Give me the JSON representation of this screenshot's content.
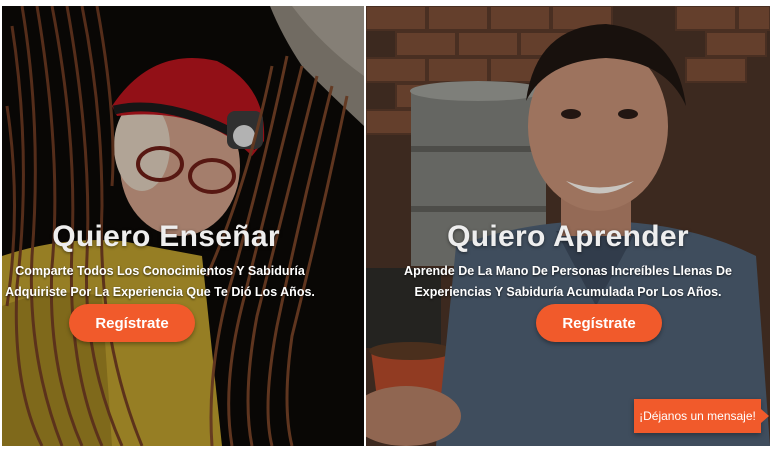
{
  "panels": {
    "teach": {
      "title": "Quiero Enseñar",
      "desc_line1": "Comparte Todos Los Conocimientos Y Sabiduría",
      "desc_line2": "Adquiriste Por La Experiencia Que Te Dió Los Años.",
      "button_label": "Regístrate"
    },
    "learn": {
      "title": "Quiero Aprender",
      "desc_line1": "Aprende De La Mano De Personas Increíbles Llenas De",
      "desc_line2": "Experiencias Y Sabiduría Acumulada Por Los Años.",
      "button_label": "Regístrate"
    }
  },
  "chat": {
    "label": "¡Déjanos un mensaje!"
  },
  "colors": {
    "accent": "#f15a2b"
  }
}
